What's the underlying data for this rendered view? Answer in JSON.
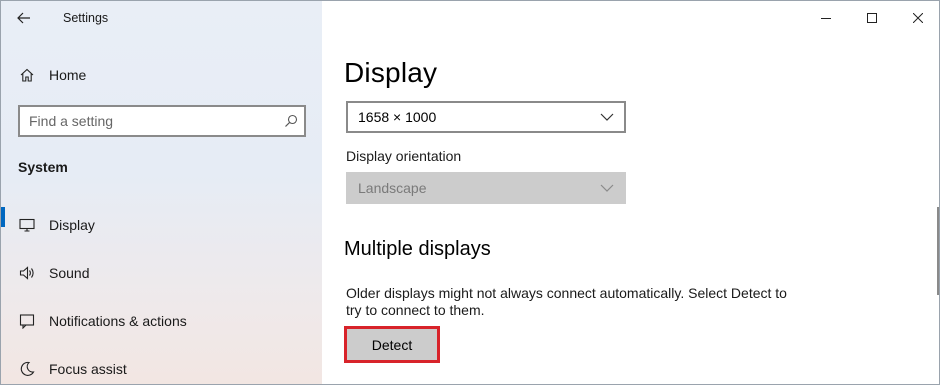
{
  "window": {
    "title": "Settings"
  },
  "sidebar": {
    "home_label": "Home",
    "search": {
      "placeholder": "Find a setting"
    },
    "section_label": "System",
    "items": [
      {
        "label": "Display",
        "icon": "monitor-icon",
        "selected": true
      },
      {
        "label": "Sound",
        "icon": "speaker-icon",
        "selected": false
      },
      {
        "label": "Notifications & actions",
        "icon": "notification-icon",
        "selected": false
      },
      {
        "label": "Focus assist",
        "icon": "moon-icon",
        "selected": false
      }
    ]
  },
  "main": {
    "page_title": "Display",
    "resolution": {
      "value": "1658 × 1000"
    },
    "orientation": {
      "label": "Display orientation",
      "value": "Landscape",
      "disabled": true
    },
    "multiple_displays": {
      "title": "Multiple displays",
      "description": "Older displays might not always connect automatically. Select Detect to try to connect to them.",
      "detect_label": "Detect"
    }
  },
  "colors": {
    "accent": "#0067c0",
    "highlight": "#d8232a",
    "button_gray": "#cccccc"
  }
}
